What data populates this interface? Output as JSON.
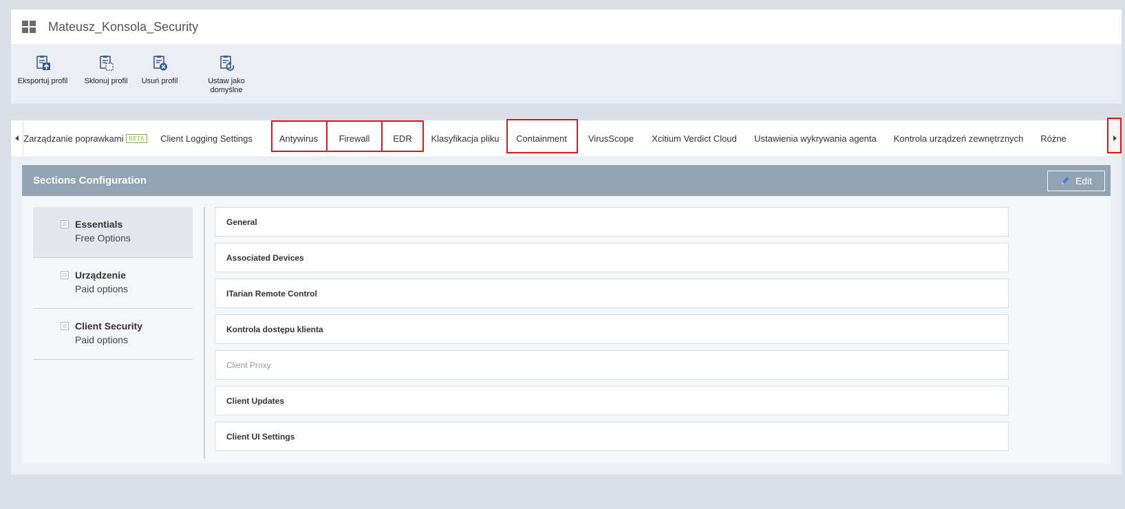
{
  "window": {
    "title": "Mateusz_Konsola_Security"
  },
  "toolbar": {
    "export_label": "Eksportuj profil",
    "clone_label": "Sklonuj profil",
    "delete_label": "Usuń profil",
    "default_label_1": "Ustaw jako",
    "default_label_2": "domyślne"
  },
  "tabs": {
    "items": [
      "Zarządzanie poprawkami",
      "Client Logging Settings",
      "Antywirus",
      "Firewall",
      "EDR",
      "Klasyfikacja pliku",
      "Containment",
      "VirusScope",
      "Xcitium Verdict Cloud",
      "Ustawienia wykrywania agenta",
      "Kontrola urządzeń zewnętrznych",
      "Różne"
    ],
    "beta_badge": "BETA",
    "highlight_color": "#e0151a"
  },
  "panel": {
    "title": "Sections Configuration",
    "edit_label": "Edit"
  },
  "left_sections": [
    {
      "name": "Essentials",
      "sub": "Free Options"
    },
    {
      "name": "Urządzenie",
      "sub": "Paid options"
    },
    {
      "name": "Client Security",
      "sub": "Paid options"
    }
  ],
  "sections": [
    "General",
    "Associated Devices",
    "ITarian Remote Control",
    "Kontrola dostępu klienta",
    "Client Proxy",
    "Client Updates",
    "Client UI Settings"
  ],
  "colors": {
    "header": "#92a3b3",
    "background": "#d9e0e7",
    "beta": "#7cb342"
  }
}
